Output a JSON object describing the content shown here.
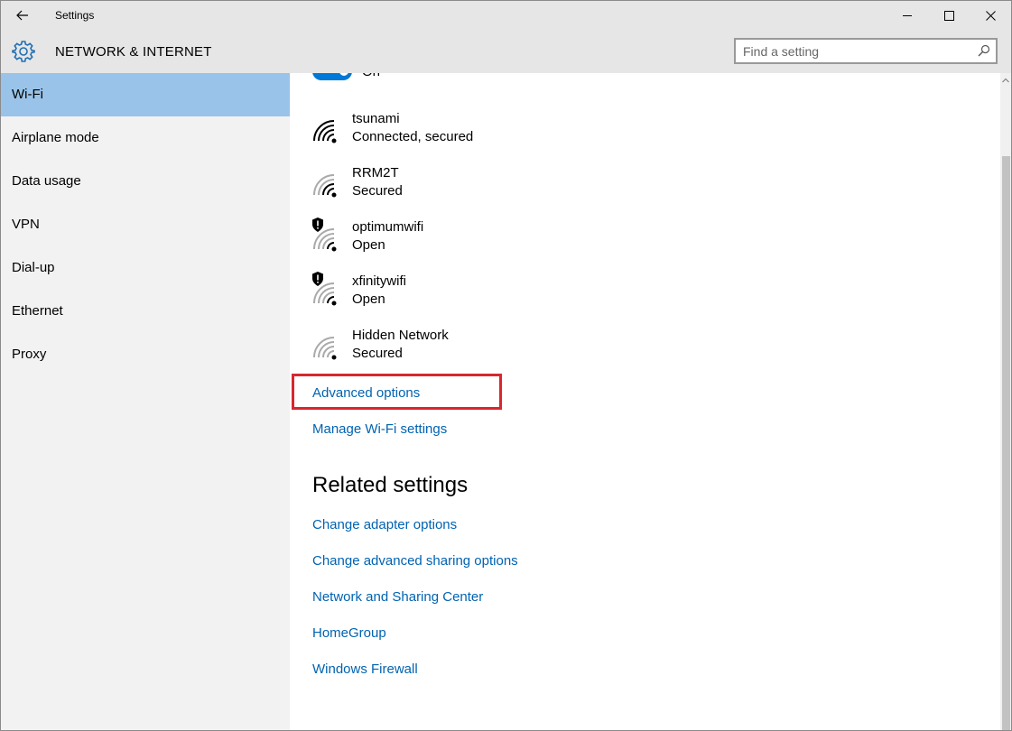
{
  "window": {
    "title": "Settings",
    "back_icon": "back-arrow-icon",
    "controls": {
      "minimize": "minimize-icon",
      "maximize": "maximize-icon",
      "close": "close-icon"
    }
  },
  "header": {
    "icon": "gear-icon",
    "title": "NETWORK & INTERNET",
    "search": {
      "placeholder": "Find a setting",
      "value": "",
      "icon": "search-icon"
    }
  },
  "sidebar": {
    "items": [
      {
        "label": "Wi-Fi",
        "selected": true
      },
      {
        "label": "Airplane mode",
        "selected": false
      },
      {
        "label": "Data usage",
        "selected": false
      },
      {
        "label": "VPN",
        "selected": false
      },
      {
        "label": "Dial-up",
        "selected": false
      },
      {
        "label": "Ethernet",
        "selected": false
      },
      {
        "label": "Proxy",
        "selected": false
      }
    ]
  },
  "main": {
    "wifi_toggle": {
      "state_label": "On",
      "on": true
    },
    "networks": [
      {
        "name": "tsunami",
        "status": "Connected, secured",
        "signal": "full",
        "warning": false
      },
      {
        "name": "RRM2T",
        "status": "Secured",
        "signal": "medium",
        "warning": false
      },
      {
        "name": "optimumwifi",
        "status": "Open",
        "signal": "medium",
        "warning": true
      },
      {
        "name": "xfinitywifi",
        "status": "Open",
        "signal": "medium",
        "warning": true
      },
      {
        "name": "Hidden Network",
        "status": "Secured",
        "signal": "weak",
        "warning": false
      }
    ],
    "links": {
      "advanced_options": "Advanced options",
      "manage_wifi": "Manage Wi-Fi settings"
    },
    "related": {
      "title": "Related settings",
      "links": [
        "Change adapter options",
        "Change advanced sharing options",
        "Network and Sharing Center",
        "HomeGroup",
        "Windows Firewall"
      ]
    }
  },
  "colors": {
    "accent": "#0078d7",
    "link": "#0063b1",
    "selected_nav": "#99c3e8",
    "highlight_box": "#d9262f"
  }
}
